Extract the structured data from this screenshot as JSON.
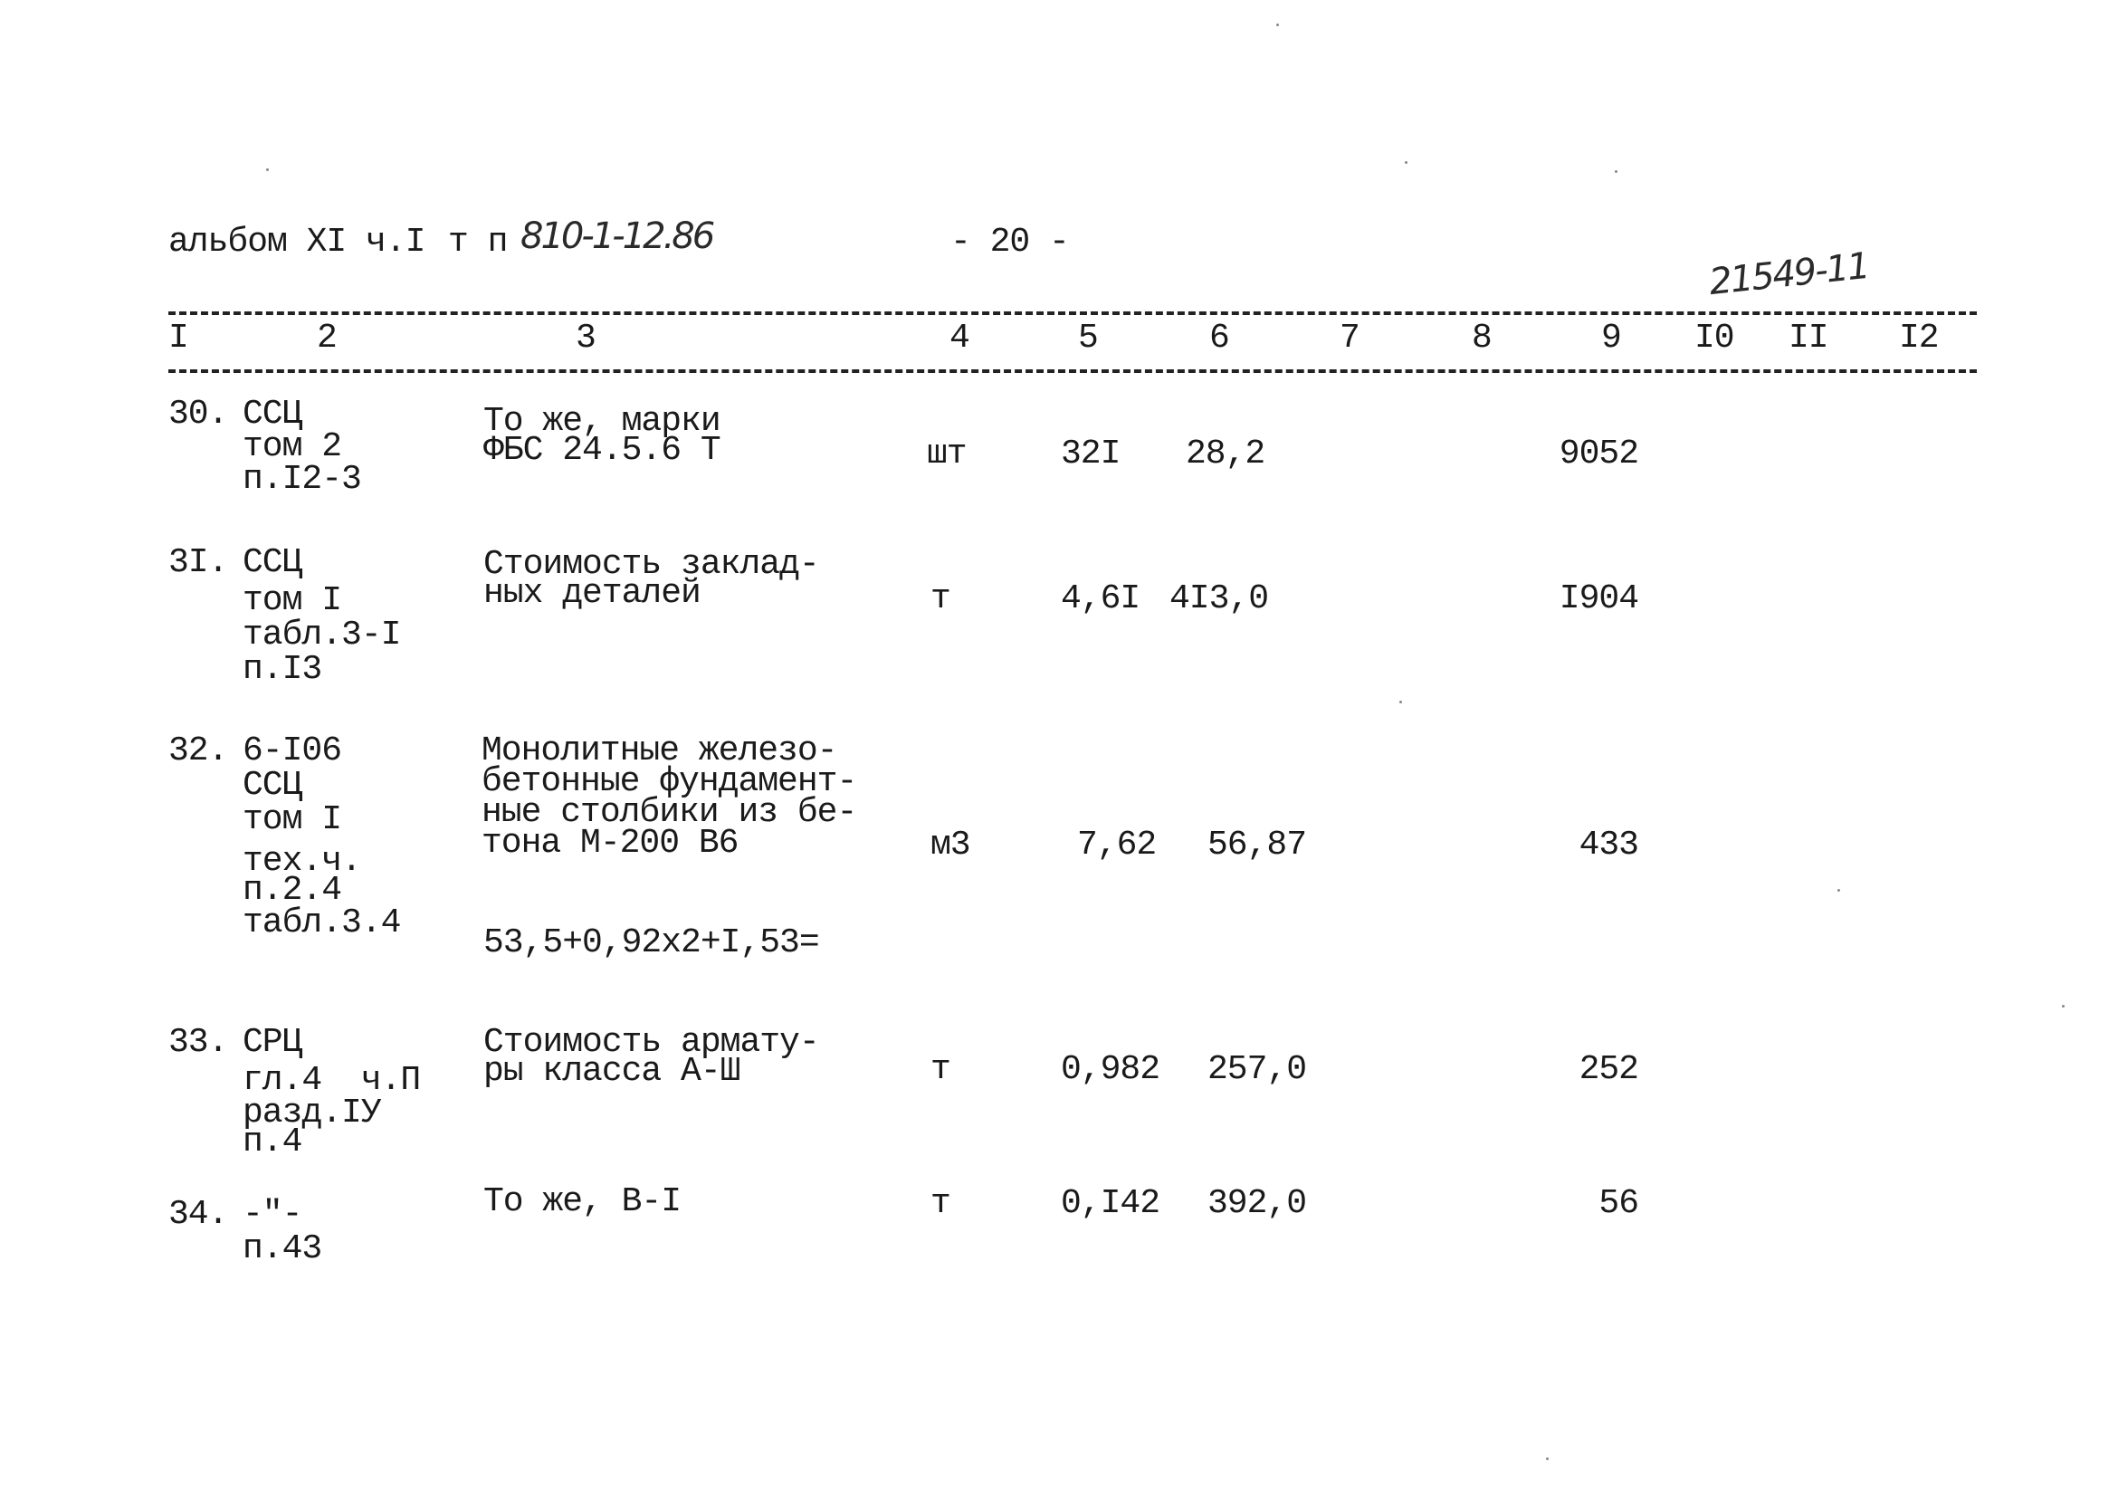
{
  "header": {
    "album": "альбом XI ч.I",
    "series_prefix": "т п",
    "series_number": "810-1-12.86",
    "page_number": "- 20 -",
    "stamp_number": "21549-11"
  },
  "columns": [
    "I",
    "2",
    "3",
    "4",
    "5",
    "6",
    "7",
    "8",
    "9",
    "I0",
    "II",
    "I2"
  ],
  "rows": [
    {
      "no": "30.",
      "reference": [
        "ССЦ",
        "том 2",
        "п.I2-3"
      ],
      "description": [
        "То же, марки",
        "ФБС 24.5.6 Т"
      ],
      "unit": "шт",
      "quantity": "32I",
      "unit_price": "28,2",
      "total": "9052"
    },
    {
      "no": "3I.",
      "reference": [
        "ССЦ",
        "том I",
        "табл.3-I",
        "п.I3"
      ],
      "description": [
        "Стоимость заклад-",
        "ных деталей"
      ],
      "unit": "т",
      "quantity": "4,6I",
      "unit_price": "4I3,0",
      "total": "I904"
    },
    {
      "no": "32.",
      "reference": [
        "6-I06",
        "ССЦ",
        "том I",
        "тех.ч.",
        "п.2.4",
        "табл.3.4"
      ],
      "description": [
        "Монолитные железо-",
        "бетонные фундамент-",
        "ные столбики из бе-",
        "тона М-200 В6"
      ],
      "formula": "53,5+0,92х2+I,53=",
      "unit": "м3",
      "quantity": "7,62",
      "unit_price": "56,87",
      "total": "433"
    },
    {
      "no": "33.",
      "reference": [
        "СРЦ",
        "гл.4  ч.П",
        "разд.IУ",
        "п.4"
      ],
      "description": [
        "Стоимость армату-",
        "ры класса А-Ш"
      ],
      "unit": "т",
      "quantity": "0,982",
      "unit_price": "257,0",
      "total": "252"
    },
    {
      "no": "34.",
      "reference": [
        "-\"-",
        "п.43"
      ],
      "description": [
        "То же, В-I"
      ],
      "unit": "т",
      "quantity": "0,I42",
      "unit_price": "392,0",
      "total": "56"
    }
  ]
}
